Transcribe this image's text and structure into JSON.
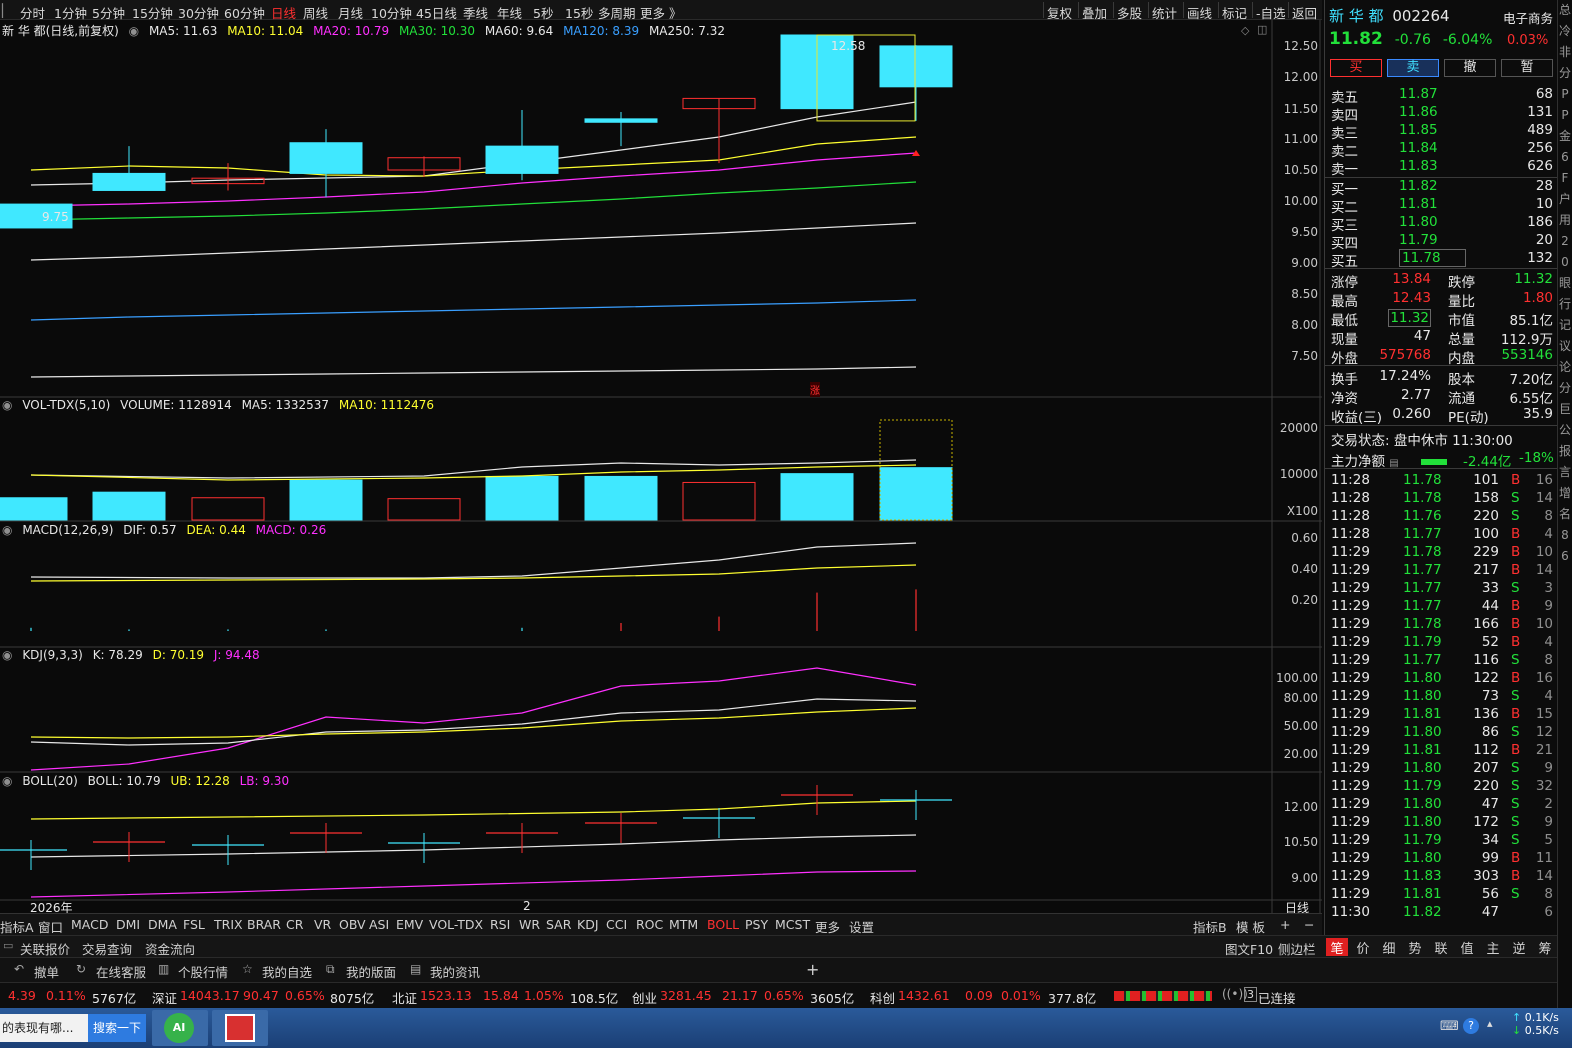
{
  "top_periods": [
    "分时",
    "1分钟",
    "5分钟",
    "15分钟",
    "30分钟",
    "60分钟",
    "日线",
    "周线",
    "月线",
    "10分钟",
    "45日线",
    "季线",
    "年线",
    "5秒",
    "15秒",
    "多周期",
    "更多 》"
  ],
  "active_period": "日线",
  "top_tools": [
    "复权",
    "叠加",
    "多股",
    "统计",
    "画线",
    "标记",
    "-自选",
    "返回"
  ],
  "chart_legend": {
    "title": "新 华 都(日线,前复权)",
    "ma5": "MA5: 11.63",
    "ma10": "MA10: 11.04",
    "ma20": "MA20: 10.79",
    "ma30": "MA30: 10.30",
    "ma60": "MA60: 9.64",
    "ma120": "MA120: 8.39",
    "ma250": "MA250: 7.32"
  },
  "vol_legend": {
    "name": "VOL-TDX(5,10)",
    "volume": "VOLUME: 1128914",
    "ma5": "MA5: 1332537",
    "ma10": "MA10: 1112476"
  },
  "macd_legend": {
    "name": "MACD(12,26,9)",
    "dif": "DIF: 0.57",
    "dea": "DEA: 0.44",
    "macd": "MACD: 0.26"
  },
  "kdj_legend": {
    "name": "KDJ(9,3,3)",
    "k": "K: 78.29",
    "d": "D: 70.19",
    "j": "J: 94.48"
  },
  "boll_legend": {
    "name": "BOLL(20)",
    "boll": "BOLL: 10.79",
    "ub": "UB: 12.28",
    "lb": "LB: 9.30"
  },
  "price_axis": [
    "12.50",
    "12.00",
    "11.50",
    "11.00",
    "10.50",
    "10.00",
    "9.50",
    "9.00",
    "8.50",
    "8.00",
    "7.50"
  ],
  "vol_axis": [
    "20000",
    "10000"
  ],
  "vol_unit": "X100",
  "macd_axis": [
    "0.60",
    "0.40",
    "0.20"
  ],
  "kdj_axis": [
    "100.00",
    "80.00",
    "50.00",
    "20.00"
  ],
  "boll_axis": [
    "12.00",
    "10.50",
    "9.00"
  ],
  "annotations": {
    "high_label": "12.58",
    "low_label": "9.75",
    "zhang_marker": "涨"
  },
  "x_axis": {
    "year_label": "2026年",
    "month_label": "2",
    "period_label": "日线"
  },
  "chart_data": {
    "type": "candlestick",
    "candles": [
      {
        "o": 10.1,
        "h": 10.1,
        "l": 9.75,
        "c": 9.75
      },
      {
        "o": 10.55,
        "h": 10.95,
        "l": 10.3,
        "c": 10.3
      },
      {
        "o": 10.4,
        "h": 10.7,
        "l": 10.3,
        "c": 10.48
      },
      {
        "o": 11.0,
        "h": 11.2,
        "l": 10.2,
        "c": 10.55
      },
      {
        "o": 10.6,
        "h": 10.8,
        "l": 10.5,
        "c": 10.78
      },
      {
        "o": 10.95,
        "h": 11.48,
        "l": 10.45,
        "c": 10.55
      },
      {
        "o": 11.35,
        "h": 11.45,
        "l": 10.95,
        "c": 11.3
      },
      {
        "o": 11.5,
        "h": 11.65,
        "l": 10.7,
        "c": 11.65
      },
      {
        "o": 12.58,
        "h": 12.58,
        "l": 11.5,
        "c": 11.5
      },
      {
        "o": 12.42,
        "h": 12.43,
        "l": 11.32,
        "c": 11.82
      }
    ],
    "volume": [
      4800,
      6000,
      4800,
      8600,
      4600,
      9400,
      9400,
      8100,
      10000,
      11289
    ],
    "price_range": [
      7.3,
      12.8
    ],
    "macd_hist": [
      0.02,
      0.01,
      0.01,
      0.01,
      0.0,
      0.02,
      0.05,
      0.09,
      0.24,
      0.26
    ]
  },
  "stock": {
    "name": "新 华 都",
    "code": "002264",
    "sector": "电子商务",
    "price": "11.82",
    "change": "-0.76",
    "pct": "-6.04%",
    "ratio": "0.03%"
  },
  "trade_buttons": [
    "买",
    "卖",
    "撤",
    "暂"
  ],
  "asks": [
    {
      "label": "卖五",
      "price": "11.87",
      "vol": "68"
    },
    {
      "label": "卖四",
      "price": "11.86",
      "vol": "131"
    },
    {
      "label": "卖三",
      "price": "11.85",
      "vol": "489"
    },
    {
      "label": "卖二",
      "price": "11.84",
      "vol": "256"
    },
    {
      "label": "卖一",
      "price": "11.83",
      "vol": "626"
    }
  ],
  "bids": [
    {
      "label": "买一",
      "price": "11.82",
      "vol": "28"
    },
    {
      "label": "买二",
      "price": "11.81",
      "vol": "10"
    },
    {
      "label": "买三",
      "price": "11.80",
      "vol": "186"
    },
    {
      "label": "买四",
      "price": "11.79",
      "vol": "20"
    },
    {
      "label": "买五",
      "price": "11.78",
      "vol": "132"
    }
  ],
  "stats": [
    {
      "l1": "涨停",
      "v1": "13.84",
      "l2": "跌停",
      "v2": "11.32"
    },
    {
      "l1": "最高",
      "v1": "12.43",
      "l2": "量比",
      "v2": "1.80"
    },
    {
      "l1": "最低",
      "v1": "11.32",
      "l2": "市值",
      "v2": "85.1亿"
    },
    {
      "l1": "现量",
      "v1": "47",
      "l2": "总量",
      "v2": "112.9万"
    },
    {
      "l1": "外盘",
      "v1": "575768",
      "l2": "内盘",
      "v2": "553146"
    },
    {
      "l1": "换手",
      "v1": "17.24%",
      "l2": "股本",
      "v2": "7.20亿"
    },
    {
      "l1": "净资",
      "v1": "2.77",
      "l2": "流通",
      "v2": "6.55亿"
    },
    {
      "l1": "收益(三)",
      "v1": "0.260",
      "l2": "PE(动)",
      "v2": "35.9"
    }
  ],
  "trade_status": "交易状态: 盘中休市 11:30:00",
  "main_flow": {
    "label": "主力净额",
    "value": "-2.44亿",
    "pct": "-18%"
  },
  "ticks": [
    {
      "t": "11:28",
      "p": "11.78",
      "v": "101",
      "s": "B",
      "n": "16"
    },
    {
      "t": "11:28",
      "p": "11.78",
      "v": "158",
      "s": "S",
      "n": "14"
    },
    {
      "t": "11:28",
      "p": "11.76",
      "v": "220",
      "s": "S",
      "n": "8"
    },
    {
      "t": "11:28",
      "p": "11.77",
      "v": "100",
      "s": "B",
      "n": "4"
    },
    {
      "t": "11:29",
      "p": "11.78",
      "v": "229",
      "s": "B",
      "n": "10"
    },
    {
      "t": "11:29",
      "p": "11.77",
      "v": "217",
      "s": "B",
      "n": "14"
    },
    {
      "t": "11:29",
      "p": "11.77",
      "v": "33",
      "s": "S",
      "n": "3"
    },
    {
      "t": "11:29",
      "p": "11.77",
      "v": "44",
      "s": "B",
      "n": "9"
    },
    {
      "t": "11:29",
      "p": "11.78",
      "v": "166",
      "s": "B",
      "n": "10"
    },
    {
      "t": "11:29",
      "p": "11.79",
      "v": "52",
      "s": "B",
      "n": "4"
    },
    {
      "t": "11:29",
      "p": "11.77",
      "v": "116",
      "s": "S",
      "n": "8"
    },
    {
      "t": "11:29",
      "p": "11.80",
      "v": "122",
      "s": "B",
      "n": "16"
    },
    {
      "t": "11:29",
      "p": "11.80",
      "v": "73",
      "s": "S",
      "n": "4"
    },
    {
      "t": "11:29",
      "p": "11.81",
      "v": "136",
      "s": "B",
      "n": "15"
    },
    {
      "t": "11:29",
      "p": "11.80",
      "v": "86",
      "s": "S",
      "n": "12"
    },
    {
      "t": "11:29",
      "p": "11.81",
      "v": "112",
      "s": "B",
      "n": "21"
    },
    {
      "t": "11:29",
      "p": "11.80",
      "v": "207",
      "s": "S",
      "n": "9"
    },
    {
      "t": "11:29",
      "p": "11.79",
      "v": "220",
      "s": "S",
      "n": "32"
    },
    {
      "t": "11:29",
      "p": "11.80",
      "v": "47",
      "s": "S",
      "n": "2"
    },
    {
      "t": "11:29",
      "p": "11.80",
      "v": "172",
      "s": "S",
      "n": "9"
    },
    {
      "t": "11:29",
      "p": "11.79",
      "v": "34",
      "s": "S",
      "n": "5"
    },
    {
      "t": "11:29",
      "p": "11.80",
      "v": "99",
      "s": "B",
      "n": "11"
    },
    {
      "t": "11:29",
      "p": "11.83",
      "v": "303",
      "s": "B",
      "n": "14"
    },
    {
      "t": "11:29",
      "p": "11.81",
      "v": "56",
      "s": "S",
      "n": "8"
    },
    {
      "t": "11:30",
      "p": "11.82",
      "v": "47",
      "s": "",
      "n": "6"
    }
  ],
  "indicator_tabs": [
    "指标A",
    "窗口",
    "MACD",
    "DMI",
    "DMA",
    "FSL",
    "TRIX",
    "BRAR",
    "CR",
    "VR",
    "OBV",
    "ASI",
    "EMV",
    "VOL-TDX",
    "RSI",
    "WR",
    "SAR",
    "KDJ",
    "CCI",
    "ROC",
    "MTM",
    "BOLL",
    "PSY",
    "MCST",
    "更多",
    "设置"
  ],
  "active_indicator": "BOLL",
  "indicator_right": [
    "指标B",
    "模 板",
    "+",
    "−"
  ],
  "func_tabs": [
    "关联报价",
    "交易查询",
    "资金流向"
  ],
  "func_right": [
    "图文F10",
    "侧边栏"
  ],
  "side_tabs": [
    "笔",
    "价",
    "细",
    "势",
    "联",
    "值",
    "主",
    "逆",
    "筹"
  ],
  "toolbar": [
    "撤单",
    "在线客服",
    "个股行情",
    "我的自选",
    "我的版面",
    "我的资讯"
  ],
  "status": [
    {
      "a": "4.39",
      "b": "0.11%",
      "c": "5767亿"
    },
    {
      "name": "深证",
      "idx": "14043.17",
      "chg": "90.47",
      "pct": "0.65%",
      "amt": "8075亿"
    },
    {
      "name": "北证",
      "idx": "1523.13",
      "chg": "15.84",
      "pct": "1.05%",
      "amt": "108.5亿"
    },
    {
      "name": "创业",
      "idx": "3281.45",
      "chg": "21.17",
      "pct": "0.65%",
      "amt": "3605亿"
    },
    {
      "name": "科创",
      "idx": "1432.61",
      "chg": "0.09",
      "pct": "0.01%",
      "amt": "377.8亿"
    }
  ],
  "connection": "已连接",
  "taskbar": {
    "search_text": "的表现有哪...",
    "search_btn": "搜索一下",
    "ai_label": "AI",
    "up_speed": "0.1K/s",
    "down_speed": "0.5K/s"
  },
  "edge_chars": [
    "总",
    "冷",
    "非",
    "分",
    "P",
    "P",
    "金",
    "6",
    "F",
    "户",
    "用",
    "2",
    "0",
    "眼",
    "行",
    "记",
    "议",
    "论",
    "分",
    "巨",
    "公",
    "报",
    "言",
    "增",
    "名",
    "8",
    "6"
  ]
}
